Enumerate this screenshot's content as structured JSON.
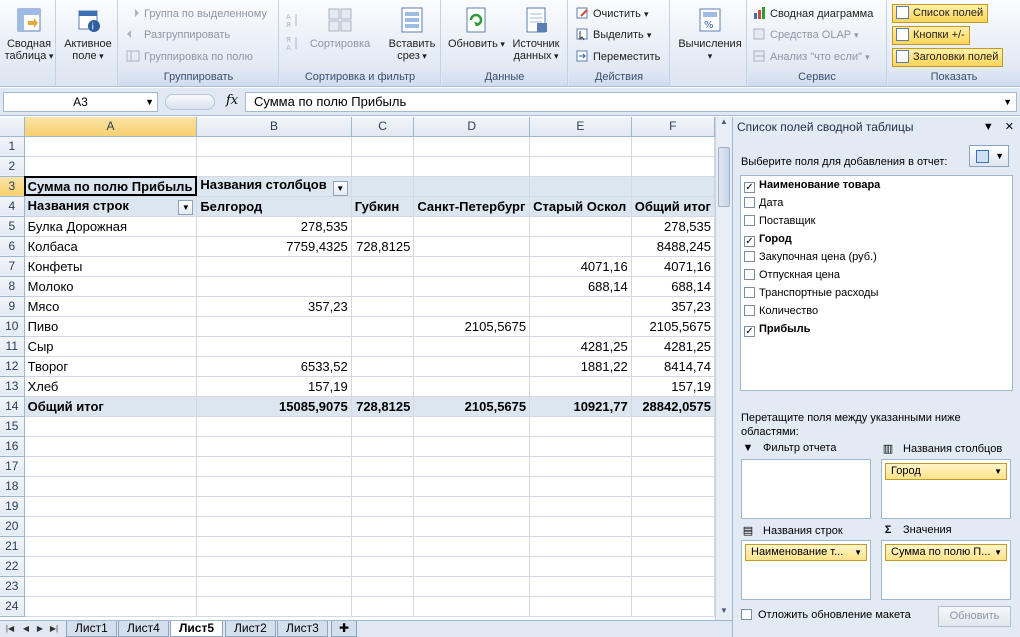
{
  "ribbon": {
    "groups": {
      "active_field_label": "",
      "group_label": "Группировать",
      "sort_label": "Сортировка и фильтр",
      "data_label": "Данные",
      "actions_label": "Действия",
      "service_label": "Сервис",
      "show_label": "Показать"
    },
    "pivot_table": {
      "line1": "Сводная",
      "line2": "таблица"
    },
    "active_field": {
      "line1": "Активное",
      "line2": "поле"
    },
    "group_selection": "Группа по выделенному",
    "ungroup": "Разгруппировать",
    "group_field": "Группировка по полю",
    "sort": "Сортировка",
    "insert_slicer": {
      "line1": "Вставить",
      "line2": "срез"
    },
    "refresh": "Обновить",
    "data_source": {
      "line1": "Источник",
      "line2": "данных"
    },
    "clear": "Очистить",
    "select": "Выделить",
    "move": "Переместить",
    "calculations": "Вычисления",
    "pivot_chart": "Сводная диаграмма",
    "olap_tools": "Средства OLAP",
    "what_if": "Анализ \"что если\"",
    "field_list": "Список полей",
    "buttons": "Кнопки +/-",
    "field_headers": "Заголовки полей"
  },
  "formula_bar": {
    "name_box": "A3",
    "fx": "fx",
    "formula": "Сумма по полю Прибыль"
  },
  "sheet": {
    "columns": [
      "A",
      "B",
      "C",
      "D",
      "E",
      "F"
    ],
    "row_numbers": [
      "1",
      "2",
      "3",
      "4",
      "5",
      "6",
      "7",
      "8",
      "9",
      "10",
      "11",
      "12",
      "13",
      "14",
      "15",
      "16",
      "17",
      "18",
      "19",
      "20",
      "21",
      "22",
      "23",
      "24"
    ],
    "r3": {
      "a": "Сумма по полю Прибыль",
      "b": "Названия столбцов"
    },
    "r4": [
      "Названия строк",
      "Белгород",
      "Губкин",
      "Санкт-Петербург",
      "Старый Оскол",
      "Общий итог"
    ],
    "rows": [
      [
        "Булка Дорожная",
        "278,535",
        "",
        "",
        "",
        "278,535"
      ],
      [
        "Колбаса",
        "7759,4325",
        "728,8125",
        "",
        "",
        "8488,245"
      ],
      [
        "Конфеты",
        "",
        "",
        "",
        "4071,16",
        "4071,16"
      ],
      [
        "Молоко",
        "",
        "",
        "",
        "688,14",
        "688,14"
      ],
      [
        "Мясо",
        "357,23",
        "",
        "",
        "",
        "357,23"
      ],
      [
        "Пиво",
        "",
        "",
        "2105,5675",
        "",
        "2105,5675"
      ],
      [
        "Сыр",
        "",
        "",
        "",
        "4281,25",
        "4281,25"
      ],
      [
        "Творог",
        "6533,52",
        "",
        "",
        "1881,22",
        "8414,74"
      ],
      [
        "Хлеб",
        "157,19",
        "",
        "",
        "",
        "157,19"
      ]
    ],
    "total": [
      "Общий итог",
      "15085,9075",
      "728,8125",
      "2105,5675",
      "10921,77",
      "28842,0575"
    ]
  },
  "tabs": [
    "Лист1",
    "Лист4",
    "Лист5",
    "Лист2",
    "Лист3"
  ],
  "active_tab": "Лист5",
  "pane": {
    "title": "Список полей сводной таблицы",
    "prompt": "Выберите поля для добавления в отчет:",
    "fields": [
      {
        "name": "Наименование товара",
        "checked": true
      },
      {
        "name": "Дата",
        "checked": false
      },
      {
        "name": "Поставщик",
        "checked": false
      },
      {
        "name": "Город",
        "checked": true
      },
      {
        "name": "Закупочная цена (руб.)",
        "checked": false
      },
      {
        "name": "Отпускная цена",
        "checked": false
      },
      {
        "name": "Транспортные расходы",
        "checked": false
      },
      {
        "name": "Количество",
        "checked": false
      },
      {
        "name": "Прибыль",
        "checked": true
      }
    ],
    "drag_hint": "Перетащите поля между указанными ниже областями:",
    "report_filter": "Фильтр отчета",
    "column_labels": "Названия столбцов",
    "row_labels": "Названия строк",
    "values": "Значения",
    "column_chip": "Город",
    "row_chip": "Наименование т...",
    "values_chip": "Сумма по полю П...",
    "defer_update": "Отложить обновление макета",
    "update_button": "Обновить"
  },
  "colors": {
    "pivot_header_fill": "#dce6f1",
    "ribbon_toggle_fill": "#ffd458",
    "active_cell_border": "#000000"
  }
}
